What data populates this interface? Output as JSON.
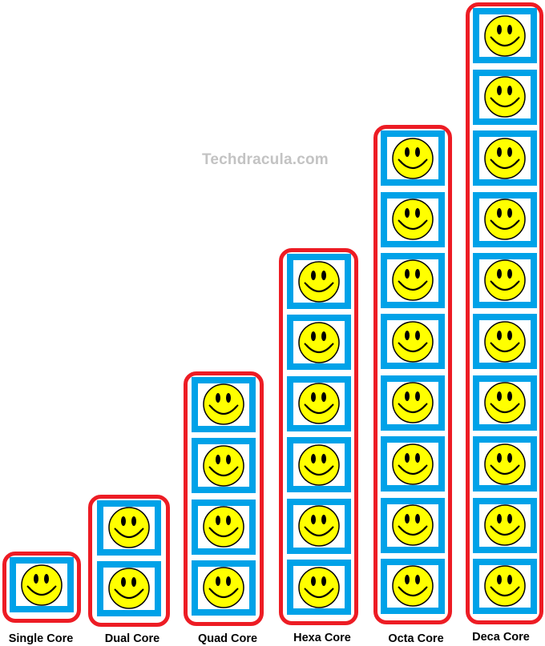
{
  "watermark": "Techdracula.com",
  "colors": {
    "group_outline": "#ed1c24",
    "core_frame": "#00a2e8",
    "smiley_face": "#ffff00",
    "watermark": "#c3c3c3"
  },
  "core_icon": "smiley-face-icon",
  "groups": [
    {
      "label": "Single Core",
      "cores": 1
    },
    {
      "label": "Dual Core",
      "cores": 2
    },
    {
      "label": "Quad Core",
      "cores": 4
    },
    {
      "label": "Hexa Core",
      "cores": 6
    },
    {
      "label": "Octa Core",
      "cores": 8
    },
    {
      "label": "Deca Core",
      "cores": 10
    }
  ]
}
